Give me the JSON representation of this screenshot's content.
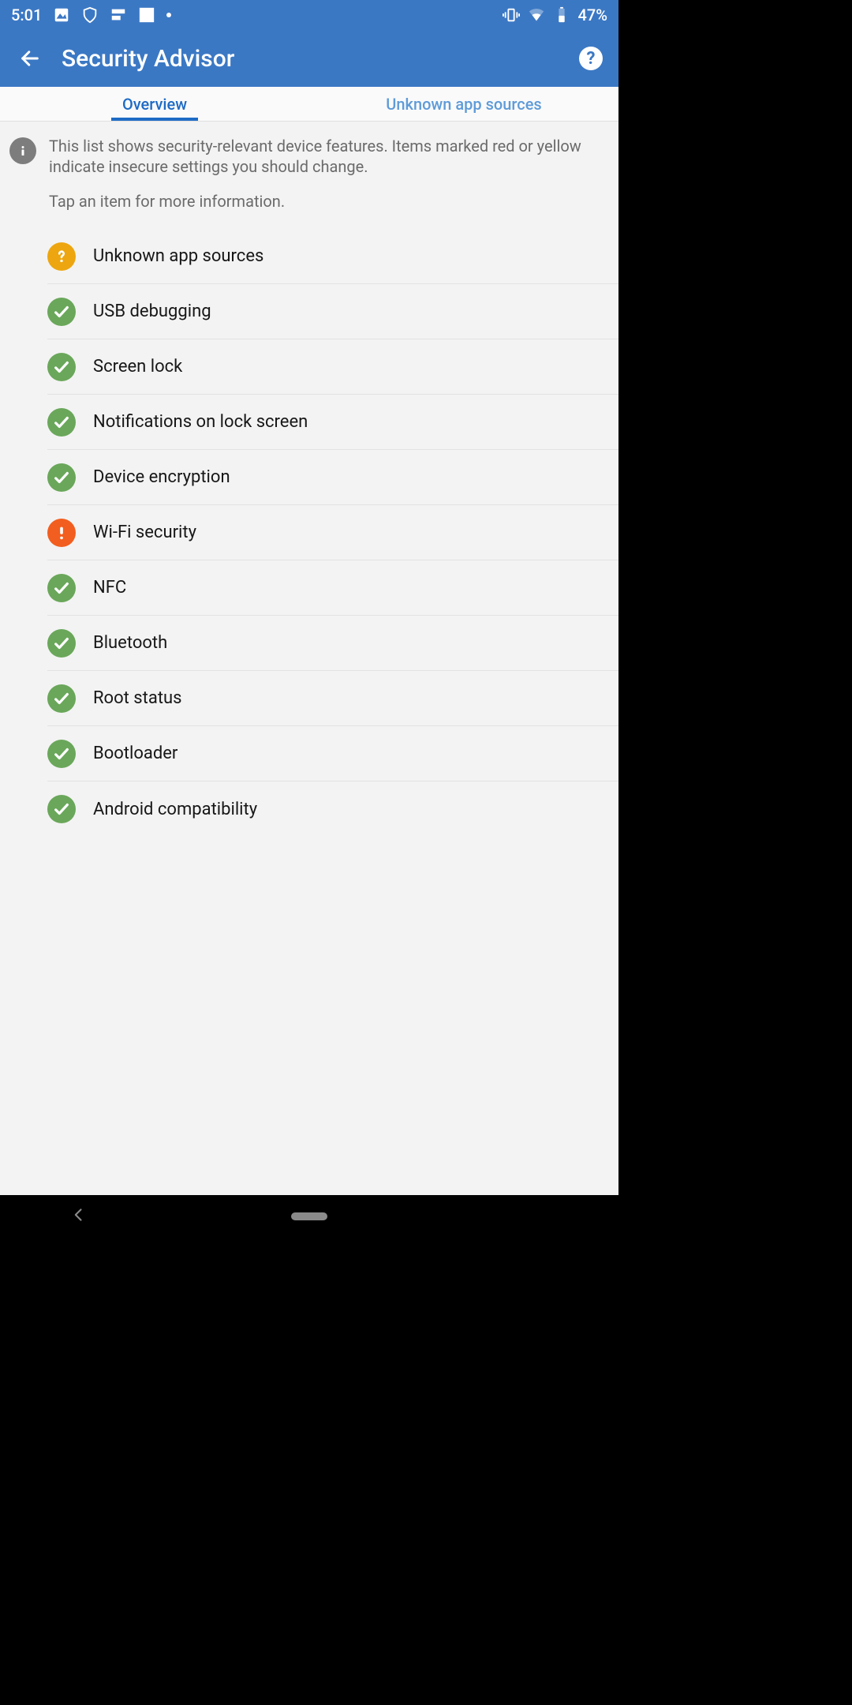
{
  "status": {
    "time": "5:01",
    "battery_pct": "47%"
  },
  "appbar": {
    "title": "Security Advisor"
  },
  "tabs": [
    {
      "label": "Overview",
      "active": true
    },
    {
      "label": "Unknown app sources",
      "active": false
    }
  ],
  "intro": {
    "line1": "This list shows security-relevant device features. Items marked red or yellow indicate insecure settings you should change.",
    "line2": "Tap an item for more information."
  },
  "items": [
    {
      "label": "Unknown app sources",
      "status": "question"
    },
    {
      "label": "USB debugging",
      "status": "ok"
    },
    {
      "label": "Screen lock",
      "status": "ok"
    },
    {
      "label": "Notifications on lock screen",
      "status": "ok"
    },
    {
      "label": "Device encryption",
      "status": "ok"
    },
    {
      "label": "Wi-Fi security",
      "status": "warning"
    },
    {
      "label": "NFC",
      "status": "ok"
    },
    {
      "label": "Bluetooth",
      "status": "ok"
    },
    {
      "label": "Root status",
      "status": "ok"
    },
    {
      "label": "Bootloader",
      "status": "ok"
    },
    {
      "label": "Android compatibility",
      "status": "ok"
    }
  ]
}
